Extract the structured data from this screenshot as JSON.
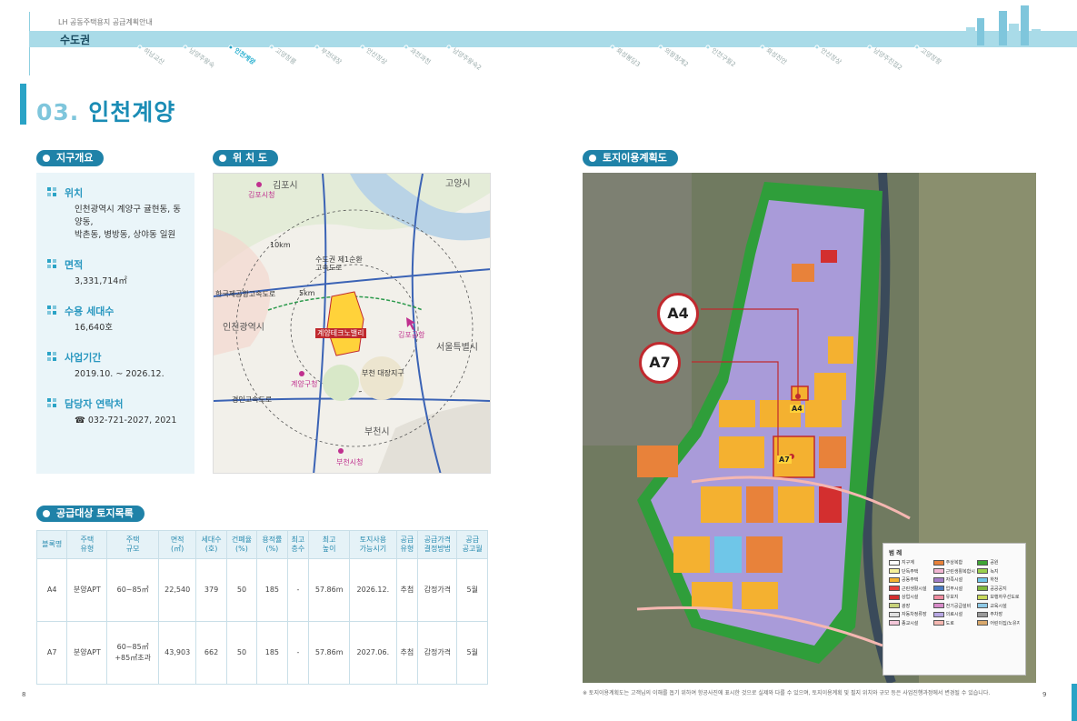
{
  "header": {
    "subtitle": "LH 공동주택용지 공급계획안내",
    "region": "수도권",
    "nav": [
      {
        "label": "하남교산",
        "active": false
      },
      {
        "label": "남양주왕숙",
        "active": false
      },
      {
        "label": "인천계양",
        "active": true
      },
      {
        "label": "고양창릉",
        "active": false
      },
      {
        "label": "부천대장",
        "active": false
      },
      {
        "label": "안산장상",
        "active": false
      },
      {
        "label": "과천과천",
        "active": false
      },
      {
        "label": "남양주왕숙2",
        "active": false
      },
      {
        "label": "화성봉담3",
        "active": false
      },
      {
        "label": "의왕청계2",
        "active": false
      },
      {
        "label": "인천구월2",
        "active": false
      },
      {
        "label": "화성진안",
        "active": false
      },
      {
        "label": "안산장상",
        "active": false
      },
      {
        "label": "남양주진접2",
        "active": false
      },
      {
        "label": "고양장항",
        "active": false
      }
    ]
  },
  "section": {
    "number": "03.",
    "title": "인천계양"
  },
  "labels": {
    "overview": "지구개요",
    "location": "위 치 도",
    "landuse": "토지이용계획도",
    "supply": "공급대상 토지목록"
  },
  "overview": [
    {
      "label": "위치",
      "value": "인천광역시 계양구 귤현동, 동양동,\n박촌동, 병방동, 상야동 일원"
    },
    {
      "label": "면적",
      "value": "3,331,714㎡"
    },
    {
      "label": "수용 세대수",
      "value": "16,640호"
    },
    {
      "label": "사업기간",
      "value": "2019.10. ~ 2026.12."
    },
    {
      "label": "담당자 연락처",
      "value": "☎ 032-721-2027, 2021"
    }
  ],
  "location_map": {
    "labels": [
      "김포시",
      "고양시",
      "김포시청",
      "인천광역시",
      "계양테크노밸리",
      "김포공항",
      "서울특별시",
      "계양구청",
      "부천시",
      "부천시청",
      "부천 대장지구",
      "수도권 제1순환 고속도로",
      "한국제공항고속도로",
      "경인고속도로",
      "5km",
      "10km"
    ]
  },
  "supply_table": {
    "headers": [
      "블록명",
      "주택\n유형",
      "주택\n규모",
      "면적\n(㎡)",
      "세대수\n(호)",
      "건폐율\n(%)",
      "용적률\n(%)",
      "최고\n층수",
      "최고\n높이",
      "토지사용\n가능시기",
      "공급\n유형",
      "공급가격\n결정방법",
      "공급\n공고월"
    ],
    "rows": [
      [
        "A4",
        "분양APT",
        "60~85㎡",
        "22,540",
        "379",
        "50",
        "185",
        "-",
        "57.86m",
        "2026.12.",
        "추첨",
        "감정가격",
        "5월"
      ],
      [
        "A7",
        "분양APT",
        "60~85㎡\n+85㎡초과",
        "43,903",
        "662",
        "50",
        "185",
        "-",
        "57.86m",
        "2027.06.",
        "추첨",
        "감정가격",
        "5월"
      ]
    ]
  },
  "landuse_map": {
    "callouts": [
      "A4",
      "A7"
    ],
    "legend_title": "범 례",
    "legend": [
      {
        "label": "지구계",
        "color": "#ffffff"
      },
      {
        "label": "주상복합",
        "color": "#e8823a"
      },
      {
        "label": "공원",
        "color": "#3fa535"
      },
      {
        "label": "단독주택",
        "color": "#f6f09a"
      },
      {
        "label": "근린생활복합시설",
        "color": "#f2b6d3"
      },
      {
        "label": "녹지",
        "color": "#9bd14d"
      },
      {
        "label": "공동주택",
        "color": "#f4b130"
      },
      {
        "label": "자족시설",
        "color": "#a27dc7"
      },
      {
        "label": "하천",
        "color": "#6fc6e8"
      },
      {
        "label": "근린생활시설",
        "color": "#e63d3d"
      },
      {
        "label": "업무시설",
        "color": "#4a7bc4"
      },
      {
        "label": "공공공지",
        "color": "#7fb83e"
      },
      {
        "label": "상업시설",
        "color": "#d32f2f"
      },
      {
        "label": "유보지",
        "color": "#f08ca0"
      },
      {
        "label": "보행자우선도로",
        "color": "#c9d95b"
      },
      {
        "label": "광장",
        "color": "#c8d27a"
      },
      {
        "label": "전기공급설비",
        "color": "#d78ac8"
      },
      {
        "label": "교육시설",
        "color": "#8ec9e6"
      },
      {
        "label": "자동차정류장",
        "color": "#e0e0e0"
      },
      {
        "label": "의료시설",
        "color": "#b7a7e3"
      },
      {
        "label": "주차장",
        "color": "#9a9a9a"
      },
      {
        "label": "종교시설",
        "color": "#f3c6d8"
      },
      {
        "label": "도로",
        "color": "#f5b7b1"
      },
      {
        "label": "어린이집/노유자시설",
        "color": "#d9a86b"
      }
    ],
    "colors": {
      "green": "#3fa535",
      "apartment": "#f4b130",
      "purple": "#a99bd9",
      "orange": "#e8823a",
      "red": "#c0292e"
    }
  },
  "footnote": "※ 토지이용계획도는 고객님의 이해를 돕기 위하여 항공사진에 표시한 것으로 실제와 다를 수 있으며, 토지이용계획 및 필지 위치와 규모 등은 사업진행과정에서 변경될 수 있습니다.",
  "pages": {
    "left": "8",
    "right": "9"
  }
}
